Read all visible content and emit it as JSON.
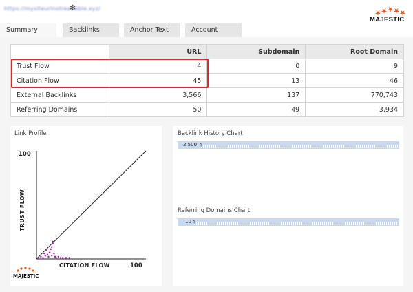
{
  "header": {
    "site_url": "https://mysiteurlnotreadable.xyz/",
    "settings_icon": "gear-icon",
    "logo_text": "MAJESTIC",
    "logo_star_color": "#e25b1c"
  },
  "tabs": [
    {
      "label": "Summary",
      "active": true
    },
    {
      "label": "Backlinks",
      "active": false
    },
    {
      "label": "Anchor Text",
      "active": false
    },
    {
      "label": "Account",
      "active": false
    }
  ],
  "summary_table": {
    "columns": [
      "",
      "URL",
      "Subdomain",
      "Root Domain"
    ],
    "rows": [
      {
        "label": "Trust Flow",
        "url": "4",
        "subdomain": "0",
        "root_domain": "9"
      },
      {
        "label": "Citation Flow",
        "url": "45",
        "subdomain": "13",
        "root_domain": "46"
      },
      {
        "label": "External Backlinks",
        "url": "3,566",
        "subdomain": "137",
        "root_domain": "770,743"
      },
      {
        "label": "Referring Domains",
        "url": "50",
        "subdomain": "49",
        "root_domain": "3,934"
      }
    ],
    "highlight_color": "#e0262b"
  },
  "link_profile": {
    "title": "Link Profile",
    "y_axis_label": "TRUST FLOW",
    "x_axis_label": "CITATION FLOW",
    "y_max_label": "100",
    "x_max_label": "100",
    "logo_text": "MAJESTIC",
    "point_color": "#a31db0",
    "points": [
      {
        "cf": 2,
        "tf": 1
      },
      {
        "cf": 4,
        "tf": 2
      },
      {
        "cf": 6,
        "tf": 1
      },
      {
        "cf": 8,
        "tf": 3
      },
      {
        "cf": 10,
        "tf": 4
      },
      {
        "cf": 12,
        "tf": 6
      },
      {
        "cf": 13,
        "tf": 9
      },
      {
        "cf": 14,
        "tf": 11
      },
      {
        "cf": 15,
        "tf": 14
      },
      {
        "cf": 15,
        "tf": 16
      },
      {
        "cf": 16,
        "tf": 5
      },
      {
        "cf": 17,
        "tf": 2
      },
      {
        "cf": 18,
        "tf": 1
      },
      {
        "cf": 20,
        "tf": 2
      },
      {
        "cf": 22,
        "tf": 1
      },
      {
        "cf": 24,
        "tf": 1
      },
      {
        "cf": 27,
        "tf": 1
      },
      {
        "cf": 30,
        "tf": 1
      },
      {
        "cf": 11,
        "tf": 2
      },
      {
        "cf": 7,
        "tf": 5
      },
      {
        "cf": 9,
        "tf": 8
      },
      {
        "cf": 14,
        "tf": 3
      }
    ]
  },
  "backlink_history": {
    "title": "Backlink History Chart",
    "value_label": "2,500"
  },
  "referring_domains_chart": {
    "title": "Referring Domains Chart",
    "value_label": "10"
  }
}
